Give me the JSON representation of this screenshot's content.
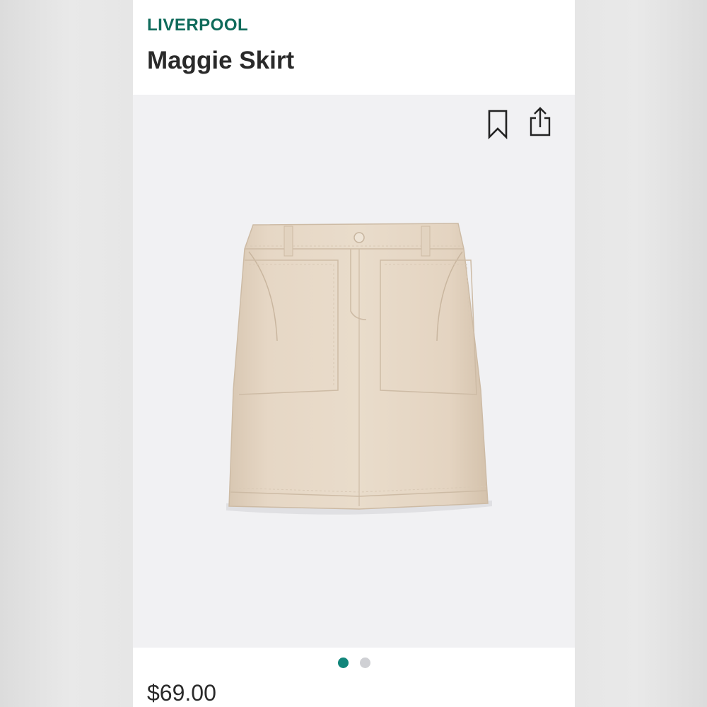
{
  "product": {
    "brand": "LIVERPOOL",
    "name": "Maggie Skirt",
    "price": "$69.00"
  },
  "actions": {
    "bookmark_icon": "bookmark-icon",
    "share_icon": "share-icon"
  },
  "image": {
    "description_icon": "skirt-image",
    "carousel": {
      "current": 1,
      "total": 2
    }
  },
  "colors": {
    "brand": "#0f6b5b",
    "dot_active": "#11857a",
    "dot_inactive": "#cfd0d4",
    "image_background": "#f1f1f3",
    "skirt": "#e4d5c3"
  }
}
